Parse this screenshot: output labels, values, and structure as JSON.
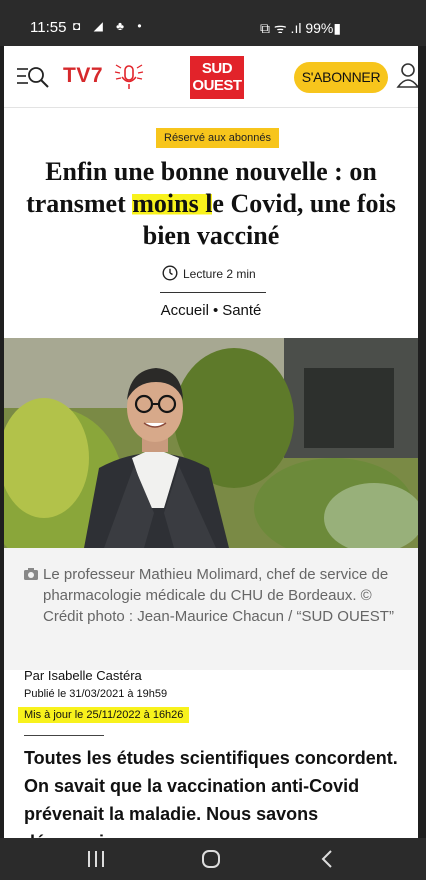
{
  "status_bar": {
    "time": "11:55",
    "left_icons": "◘ ◢ ♣ •",
    "right_text": "⧉ ᯤ .ıl 99%▮"
  },
  "header": {
    "tv7_label": "TV7",
    "logo_line1": "SUD",
    "logo_line2": "OUEST",
    "subscribe_label": "S'ABONNER",
    "accent_color": "#f7c51c",
    "brand_color": "#e2232a"
  },
  "article": {
    "badge": "Réservé aux abonnés",
    "title_part1": "Enfin une bonne nouvelle : on transmet ",
    "title_highlight": "moins l",
    "title_part2": "e Covid, une fois bien vacciné",
    "reading_time": "Lecture 2 min",
    "breadcrumb_home": "Accueil",
    "breadcrumb_sep": "•",
    "breadcrumb_section": "Santé",
    "caption": "Le professeur Mathieu Molimard, chef de service de pharmacologie médicale du CHU de Bordeaux. © Crédit photo : Jean-Maurice Chacun / “SUD OUEST”",
    "author": "Par Isabelle Castéra",
    "published": "Publié le 31/03/2021 à 19h59",
    "updated": "Mis à jour le 25/11/2022 à 16h26",
    "lead": "Toutes les études scientifiques concordent. On savait que la vaccination anti-Covid prévenait la maladie. Nous savons désormais",
    "highlight_color": "#f8f21c"
  },
  "icons": {
    "search": "search-icon",
    "microphone": "microphone-icon",
    "user": "user-icon",
    "clock": "clock-icon",
    "camera": "camera-icon",
    "nav_recents": "recents-icon",
    "nav_home": "home-icon",
    "nav_back": "back-icon"
  }
}
